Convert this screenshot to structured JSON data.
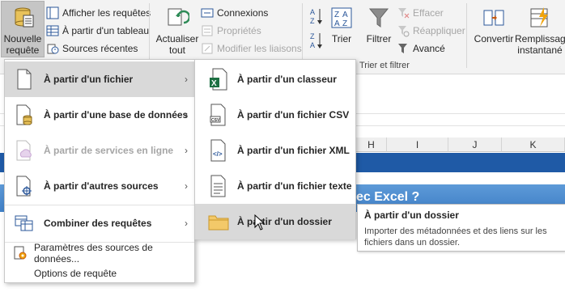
{
  "ribbon": {
    "nouvelle_requete": "Nouvelle requête",
    "afficher_requetes": "Afficher les requêtes",
    "partir_tableau": "À partir d'un tableau",
    "sources_recentes": "Sources récentes",
    "actualiser_tout": "Actualiser tout",
    "connexions": "Connexions",
    "proprietes": "Propriétés",
    "modifier_liaisons": "Modifier les liaisons",
    "trier": "Trier",
    "filtrer": "Filtrer",
    "effacer": "Effacer",
    "reappliquer": "Réappliquer",
    "avance": "Avancé",
    "trier_filtrer_group": "Trier et filtrer",
    "convertir": "Convertir",
    "remplissage": "Remplissage instantané"
  },
  "sheet": {
    "columns": [
      "H",
      "I",
      "J",
      "K"
    ],
    "banner_text": "ec Excel ?"
  },
  "menu1": {
    "items": [
      {
        "label": "À partir d'un fichier",
        "icon": "file-icon",
        "arrow": "›"
      },
      {
        "label": "À partir d'une base de données",
        "icon": "database-icon",
        "arrow": "›"
      },
      {
        "label": "À partir de services en ligne",
        "icon": "cloud-icon",
        "arrow": "›"
      },
      {
        "label": "À partir d'autres sources",
        "icon": "other-sources-icon",
        "arrow": "›"
      },
      {
        "label": "Combiner des requêtes",
        "icon": "combine-icon",
        "arrow": "›"
      },
      {
        "label": "Paramètres des sources de données...",
        "icon": "settings-icon"
      },
      {
        "label": "Options de requête",
        "icon": ""
      }
    ]
  },
  "menu2": {
    "items": [
      {
        "label": "À partir d'un classeur",
        "icon": "excel-workbook-icon"
      },
      {
        "label": "À partir d'un fichier CSV",
        "icon": "csv-icon"
      },
      {
        "label": "À partir d'un fichier XML",
        "icon": "xml-icon"
      },
      {
        "label": "À partir d'un fichier texte",
        "icon": "text-file-icon"
      },
      {
        "label": "À partir d'un dossier",
        "icon": "folder-icon"
      }
    ]
  },
  "tooltip": {
    "title": "À partir d'un dossier",
    "body": "Importer des métadonnées et des liens sur les fichiers dans un dossier."
  },
  "colors": {
    "excel_green": "#1d6f42",
    "banner_blue": "#1f5aa6",
    "highlight": "#d9d9d9"
  }
}
